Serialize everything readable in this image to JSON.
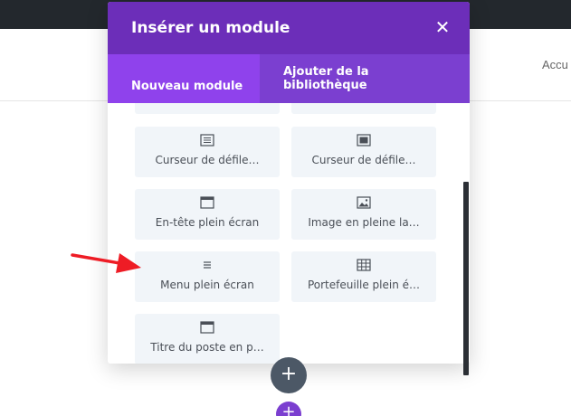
{
  "nav": {
    "partial_link": "Accu"
  },
  "modal": {
    "title": "Insérer un module",
    "close_glyph": "✕",
    "tabs": [
      {
        "label": "Nouveau module"
      },
      {
        "label": "Ajouter de la bibliothèque"
      }
    ]
  },
  "modules": [
    {
      "label": "",
      "icon": "partial-module-icon"
    },
    {
      "label": "",
      "icon": "partial-module-icon"
    },
    {
      "label": "Curseur de défile…",
      "icon": "slider-icon"
    },
    {
      "label": "Curseur de défile…",
      "icon": "image-slider-icon"
    },
    {
      "label": "En-tête plein écran",
      "icon": "header-window-icon"
    },
    {
      "label": "Image en pleine la…",
      "icon": "image-icon"
    },
    {
      "label": "Menu plein écran",
      "icon": "menu-icon"
    },
    {
      "label": "Portefeuille plein é…",
      "icon": "grid-icon"
    },
    {
      "label": "Titre du poste en p…",
      "icon": "window-icon"
    }
  ],
  "buttons": {
    "add_glyph": "+",
    "add_row_glyph": "+"
  },
  "colors": {
    "header": "#6c2eb9",
    "tabs": "#7b3fd0",
    "active_tab": "#8f42ec",
    "arrow": "#ee1c25"
  }
}
